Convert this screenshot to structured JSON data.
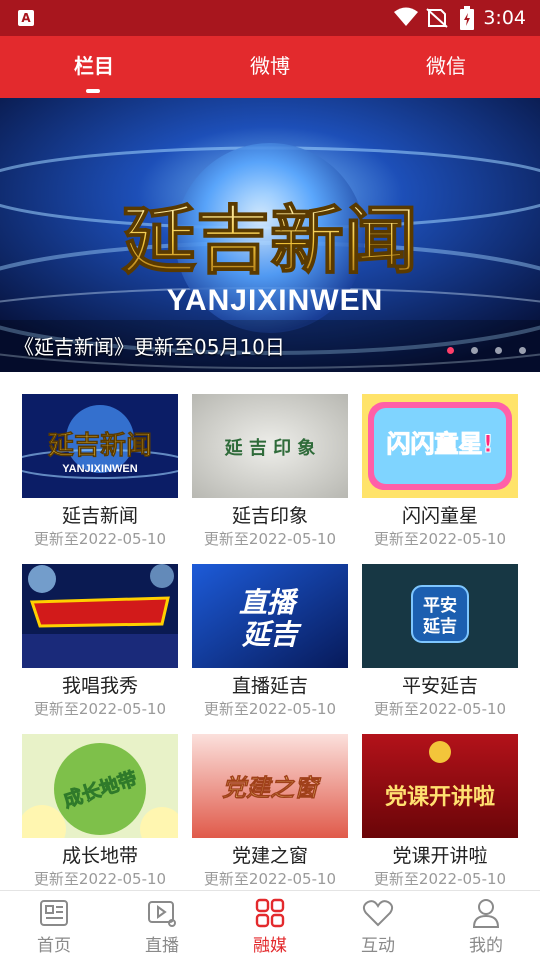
{
  "status_bar": {
    "time": "3:04"
  },
  "tabs": [
    {
      "label": "栏目"
    },
    {
      "label": "微博"
    },
    {
      "label": "微信"
    }
  ],
  "banner": {
    "title_art": "延吉新闻",
    "subtitle_art": "YANJIXINWEN",
    "caption": "《延吉新闻》更新至05月10日",
    "page_count": 4,
    "current_page": 1
  },
  "programs": [
    {
      "title": "延吉新闻",
      "updated": "更新至2022-05-10",
      "thumb_text": "延吉新闻",
      "thumb_sub": "YANJIXINWEN"
    },
    {
      "title": "延吉印象",
      "updated": "更新至2022-05-10",
      "thumb_text": "延 吉 印 象"
    },
    {
      "title": "闪闪童星",
      "updated": "更新至2022-05-10",
      "thumb_text": "闪闪童星!"
    },
    {
      "title": "我唱我秀",
      "updated": "更新至2022-05-10",
      "thumb_text": ""
    },
    {
      "title": "直播延吉",
      "updated": "更新至2022-05-10",
      "thumb_text": "直播",
      "thumb_sub": "延吉"
    },
    {
      "title": "平安延吉",
      "updated": "更新至2022-05-10",
      "thumb_text": "平安",
      "thumb_sub": "延吉"
    },
    {
      "title": "成长地带",
      "updated": "更新至2022-05-10",
      "thumb_text": "成长地带"
    },
    {
      "title": "党建之窗",
      "updated": "更新至2022-05-10",
      "thumb_text": "党建之窗"
    },
    {
      "title": "党课开讲啦",
      "updated": "更新至2022-05-10",
      "thumb_text": "党课开讲啦"
    }
  ],
  "bottom_nav": [
    {
      "label": "首页",
      "icon": "news-icon"
    },
    {
      "label": "直播",
      "icon": "video-icon"
    },
    {
      "label": "融媒",
      "icon": "grid-icon",
      "active": true
    },
    {
      "label": "互动",
      "icon": "heart-icon"
    },
    {
      "label": "我的",
      "icon": "user-icon"
    }
  ],
  "colors": {
    "tab_bar": "#e32a2d",
    "status_bar": "#a8161e",
    "active": "#e32a2d"
  }
}
